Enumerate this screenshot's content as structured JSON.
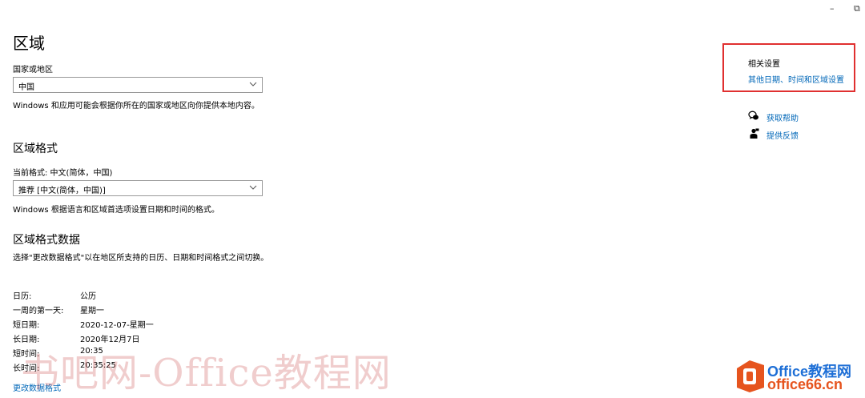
{
  "window": {
    "minimize_glyph": "–",
    "restore_glyph": "⧉"
  },
  "main": {
    "title": "区域",
    "country": {
      "label": "国家或地区",
      "value": "中国",
      "description": "Windows 和应用可能会根据你所在的国家或地区向你提供本地内容。"
    },
    "format": {
      "heading": "区域格式",
      "current_label": "当前格式: 中文(简体，中国)",
      "value": "推荐 [中文(简体，中国)]",
      "description": "Windows 根据语言和区域首选项设置日期和时间的格式。"
    },
    "format_data": {
      "heading": "区域格式数据",
      "description": "选择\"更改数据格式\"以在地区所支持的日历、日期和时间格式之间切换。",
      "rows": [
        {
          "key": "日历:",
          "value": "公历"
        },
        {
          "key": "一周的第一天:",
          "value": "星期一"
        },
        {
          "key": "短日期:",
          "value": "2020-12-07-星期一"
        },
        {
          "key": "长日期:",
          "value": "2020年12月7日"
        },
        {
          "key": "短时间:",
          "value": "20:35"
        },
        {
          "key": "长时间:",
          "value": "20:35:25"
        }
      ],
      "change_link": "更改数据格式"
    }
  },
  "sidebar": {
    "related_title": "相关设置",
    "related_link": "其他日期、时间和区域设置",
    "help_link": "获取帮助",
    "feedback_link": "提供反馈",
    "highlight_color": "#e03030",
    "link_color": "#0067b8"
  },
  "watermark": {
    "text": "书吧网-Office教程网",
    "brand_line1": "Office教程网",
    "brand_line2": "office66.cn"
  }
}
